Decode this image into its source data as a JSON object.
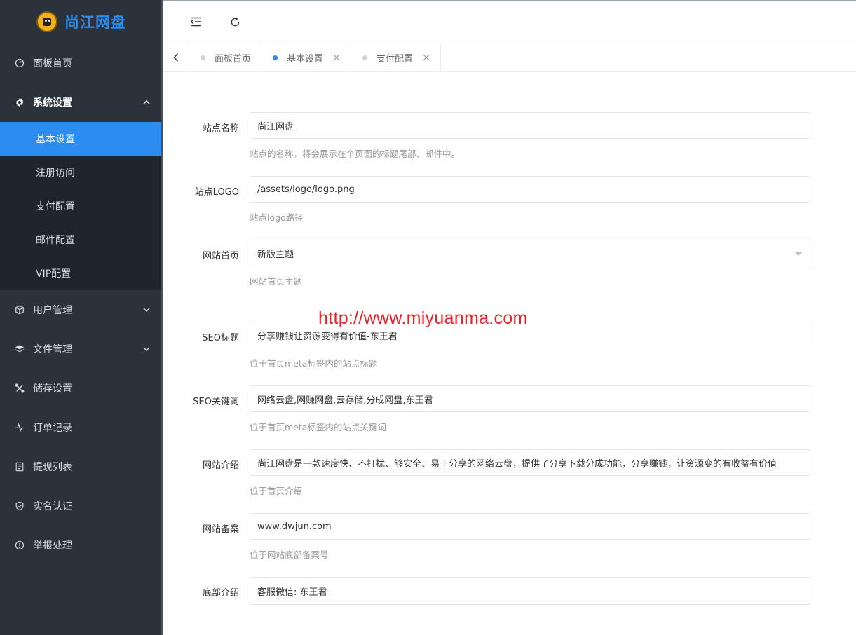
{
  "brand": {
    "name": "尚江网盘",
    "color": "#2d8cf0"
  },
  "sidebar": {
    "items": [
      {
        "label": "面板首页",
        "icon": "gauge-icon"
      },
      {
        "label": "系统设置",
        "icon": "gear-icon",
        "expanded": true,
        "children": [
          "基本设置",
          "注册访问",
          "支付配置",
          "邮件配置",
          "VIP配置"
        ],
        "active_child": "基本设置"
      },
      {
        "label": "用户管理",
        "icon": "cube-icon",
        "expandable": true
      },
      {
        "label": "文件管理",
        "icon": "layers-icon",
        "expandable": true
      },
      {
        "label": "储存设置",
        "icon": "tools-icon"
      },
      {
        "label": "订单记录",
        "icon": "pulse-icon"
      },
      {
        "label": "提现列表",
        "icon": "list-doc-icon"
      },
      {
        "label": "实名认证",
        "icon": "shield-check-icon"
      },
      {
        "label": "举报处理",
        "icon": "info-circle-icon"
      }
    ]
  },
  "topbar": {
    "buttons": [
      "collapse-menu-icon",
      "refresh-icon"
    ]
  },
  "tabs": [
    {
      "label": "面板首页",
      "closable": false,
      "active": false
    },
    {
      "label": "基本设置",
      "closable": true,
      "active": true
    },
    {
      "label": "支付配置",
      "closable": true,
      "active": false
    }
  ],
  "form": {
    "site_name": {
      "label": "站点名称",
      "value": "尚江网盘",
      "help": "站点的名称，将会展示在个页面的标题尾部、邮件中。"
    },
    "site_logo": {
      "label": "站点LOGO",
      "value": "/assets/logo/logo.png",
      "help": "站点logo路径"
    },
    "home_theme": {
      "label": "网站首页",
      "value": "新版主题",
      "help": "网站首页主题"
    },
    "seo_title": {
      "label": "SEO标题",
      "value": "分享赚钱让资源变得有价值-东王君",
      "help": "位于首页meta标签内的站点标题"
    },
    "seo_keywords": {
      "label": "SEO关键词",
      "value": "网络云盘,网赚网盘,云存储,分成网盘,东王君",
      "help": "位于首页meta标签内的站点关键词"
    },
    "site_intro": {
      "label": "网站介绍",
      "value": "尚江网盘是一款速度快、不打扰、够安全、易于分享的网络云盘，提供了分享下载分成功能，分享赚钱，让资源变的有收益有价值",
      "help": "位于首页介绍"
    },
    "icp": {
      "label": "网站备案",
      "value": "www.dwjun.com",
      "help": "位于网站底部备案号"
    },
    "footer": {
      "label": "底部介绍",
      "value": "客服微信: 东王君"
    }
  },
  "watermark": "http://www.miyuanma.com"
}
